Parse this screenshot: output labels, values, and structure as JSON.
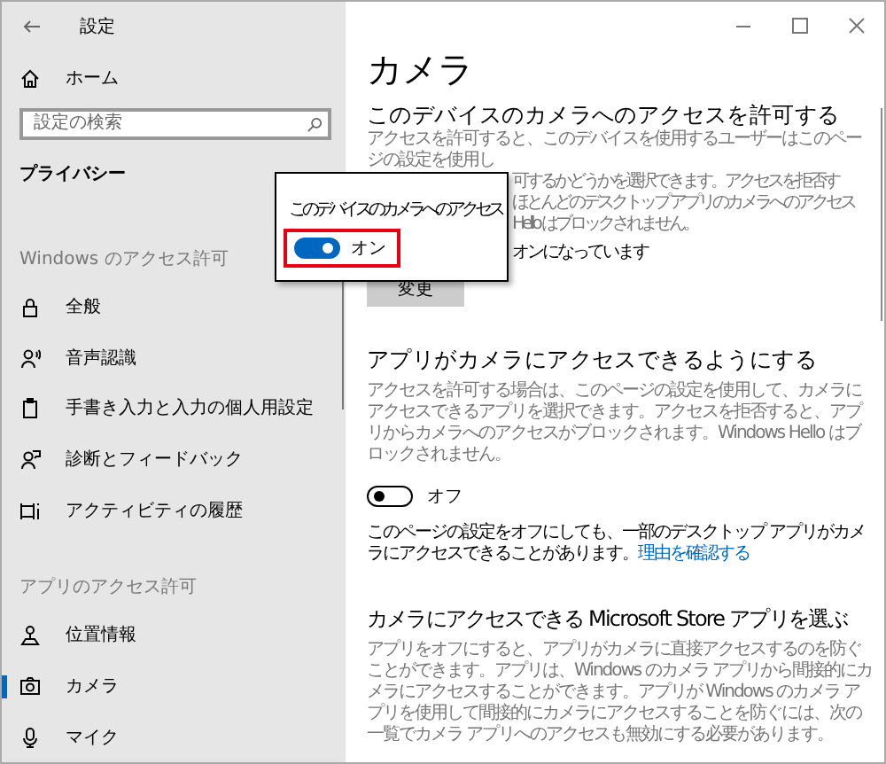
{
  "window": {
    "title": "設定"
  },
  "sidebar": {
    "home": "ホーム",
    "search": {
      "placeholder": "設定の検索"
    },
    "category": "プライバシー",
    "groups": [
      {
        "heading": "Windows のアクセス許可",
        "items": [
          {
            "label": "全般",
            "selected": false
          },
          {
            "label": "音声認識",
            "selected": false
          },
          {
            "label": "手書き入力と入力の個人用設定",
            "selected": false
          },
          {
            "label": "診断とフィードバック",
            "selected": false
          },
          {
            "label": "アクティビティの履歴",
            "selected": false
          }
        ]
      },
      {
        "heading": "アプリのアクセス許可",
        "items": [
          {
            "label": "位置情報",
            "selected": false
          },
          {
            "label": "カメラ",
            "selected": true
          },
          {
            "label": "マイク",
            "selected": false
          }
        ]
      }
    ]
  },
  "main": {
    "title": "カメラ",
    "device_section": {
      "heading": "このデバイスのカメラへのアクセスを許可する",
      "first_line": "アクセスを許可すると、このデバイスを使用するユーザーはこのページの設定を使用し",
      "visible_lines": [
        "可するかどうかを選択できます。アクセスを拒否す",
        "ほとんどのデスクトップ アプリのカメラへのアクセス",
        "Hello はブロックされません。"
      ],
      "status": "オンになっています",
      "button": "変更"
    },
    "popup": {
      "label": "このデバイスのカメラへのアクセス",
      "toggle": {
        "on": true,
        "label": "オン"
      },
      "highlighted": true
    },
    "apps_section": {
      "heading": "アプリがカメラにアクセスできるようにする",
      "description": "アクセスを許可する場合は、このページの設定を使用して、カメラにアクセスできるアプリを選択できます。アクセスを拒否すると、アプリからカメラへのアクセスがブロックされます。Windows Hello はブロックされません。",
      "toggle": {
        "on": false,
        "label": "オフ"
      },
      "note": "このページの設定をオフにしても、一部のデスクトップ アプリがカメラにアクセスできることがあります。",
      "note_link": "理由を確認する"
    },
    "store_section": {
      "heading": "カメラにアクセスできる Microsoft Store アプリを選ぶ",
      "description": "アプリをオフにすると、アプリがカメラに直接アクセスするのを防ぐことができます。アプリは、Windows のカメラ アプリから間接的にカメラにアクセスすることができます。アプリが Windows のカメラ アプリを使用して間接的にカメラにアクセスすることを防ぐには、次の一覧でカメラ アプリへのアクセスも無効にする必要があります。"
    }
  }
}
